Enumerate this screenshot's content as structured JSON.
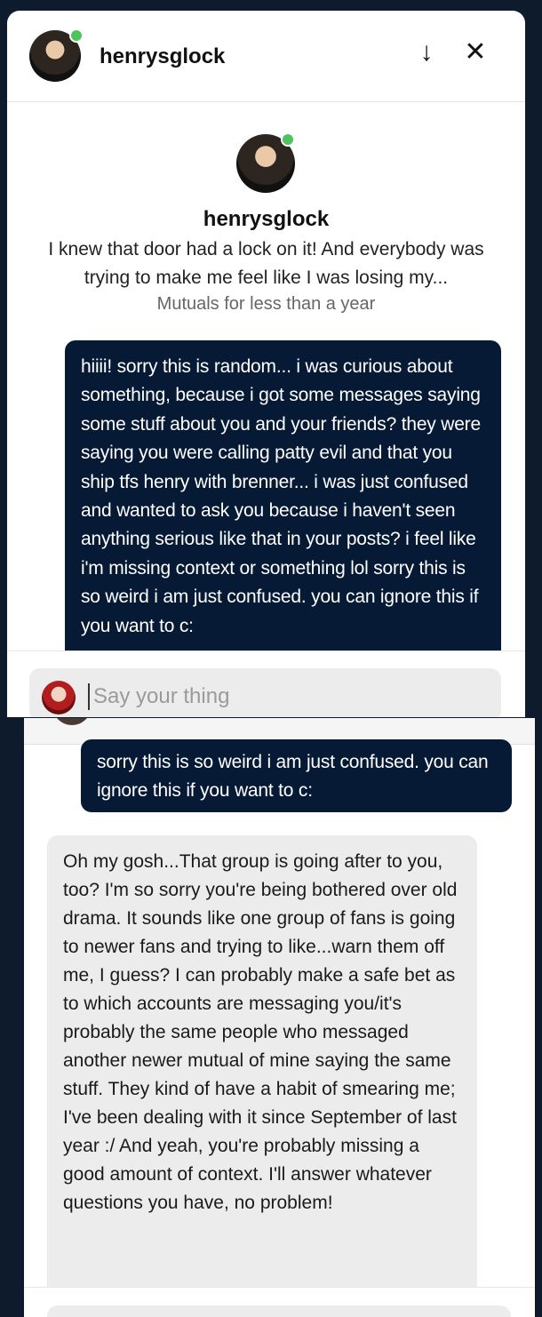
{
  "conversation": {
    "username": "henrysglock",
    "online_status_color": "#4fc35b"
  },
  "header": {
    "title": "henrysglock",
    "minimize_icon": "arrow-down-icon",
    "close_icon": "close-icon"
  },
  "profile": {
    "name": "henrysglock",
    "bio": "I knew that door had a lock on it! And everybody was trying to make me feel like I was losing my...",
    "relationship": "Mutuals for less than a year"
  },
  "messages": [
    {
      "direction": "outgoing",
      "text": "hiiii! sorry this is random... i was curious about something, because i got some messages saying some stuff about you and your friends? they were saying you were calling patty evil and that you ship tfs henry with brenner... i was just confused and wanted to ask you because i haven't seen anything serious like that in your posts? i feel like i'm missing context or something lol sorry this is so weird i am just confused. you can ignore this if you want to c:"
    },
    {
      "direction": "incoming",
      "text": "Oh my gosh...That group is going after to you, too? I'm so sorry you're being bothered over old drama. It sounds like one group of fans is going to newer fans and trying to like...warn them off me, I guess? I can probably make a safe bet as to which accounts are messaging you/it's probably the same people who messaged another newer mutual of mine saying the same stuff. They kind of have a habit of smearing me; I've been dealing with it since September of last year :/ And yeah, you're probably missing a good amount of context. I'll answer whatever questions you have, no problem!"
    }
  ],
  "message_tail": "sorry this is so weird i am just confused. you can ignore this if you want to c:",
  "composer": {
    "placeholder": "Say your thing"
  },
  "colors": {
    "outgoing_bubble": "#061a36",
    "incoming_bubble": "#ececec",
    "background": "#0f1c2e"
  }
}
